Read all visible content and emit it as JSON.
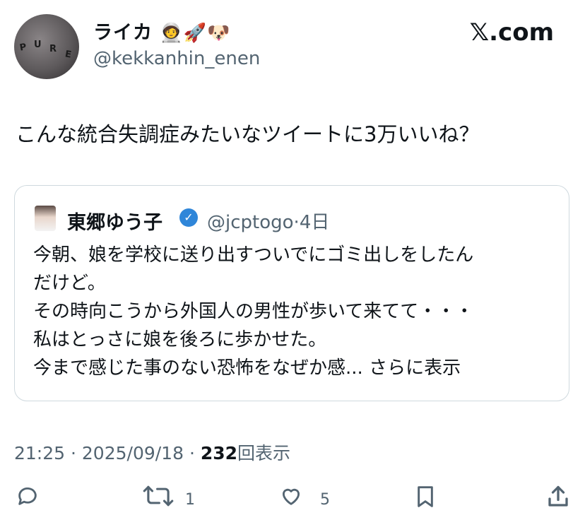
{
  "author": {
    "display_name": "ライカ",
    "name_emojis": "🧑‍🚀🚀🐶",
    "handle": "@kekkanhin_enen",
    "avatar_text": [
      "P",
      "U",
      "R",
      "E"
    ]
  },
  "site": "𝕏.com",
  "tweet_text": "こんな統合失調症みたいなツイートに3万いいね？",
  "quote": {
    "name": "東郷ゆう子",
    "handle": "@jcptogo",
    "separator": "·",
    "time": "4日",
    "lines": [
      "今朝、娘を学校に送り出すついでにゴミ出しをしたん",
      "だけど。",
      "その時向こうから外国人の男性が歩いて来てて・・・",
      "私はとっさに娘を後ろに歩かせた。",
      "今まで感じた事のない恐怖をなぜか感..."
    ],
    "show_more": "さらに表示"
  },
  "meta": {
    "time": "21:25",
    "date": "2025/09/18",
    "separator": "·",
    "views": "232",
    "views_label": "回表示"
  },
  "actions": {
    "retweet_count": "1",
    "like_count": "5"
  },
  "icons": [
    "reply-icon",
    "retweet-icon",
    "like-icon",
    "bookmark-icon",
    "share-icon",
    "verified-icon"
  ],
  "colors": {
    "text": "#0f1419",
    "secondary": "#536471",
    "border": "#cfd9de",
    "verified": "#2f86d9"
  }
}
